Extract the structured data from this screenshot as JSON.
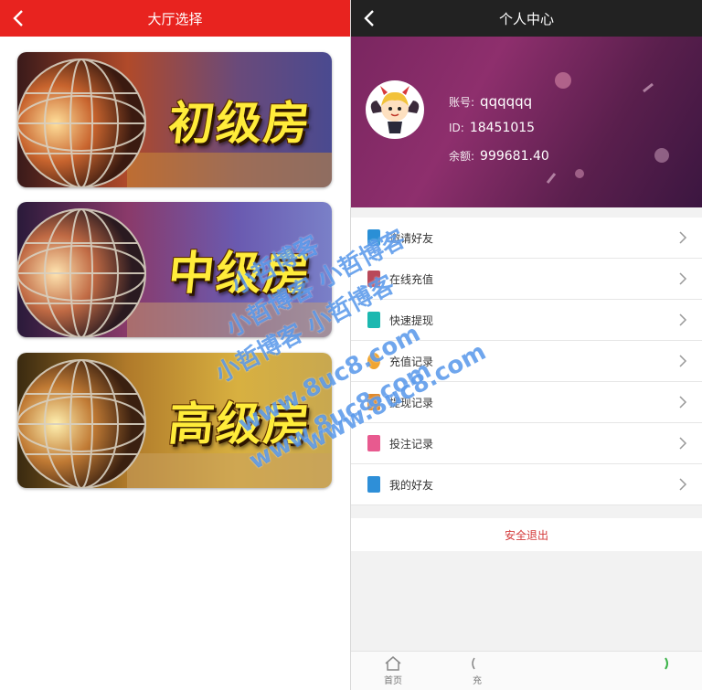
{
  "left": {
    "header": {
      "title": "大厅选择"
    },
    "rooms": [
      {
        "label": "初级房"
      },
      {
        "label": "中级房"
      },
      {
        "label": "高级房"
      }
    ]
  },
  "right": {
    "header": {
      "title": "个人中心"
    },
    "profile": {
      "account_label": "账号:",
      "account": "qqqqqq",
      "id_label": "ID:",
      "id": "18451015",
      "balance_label": "余额:",
      "balance": "999681.40"
    },
    "menu": [
      {
        "label": "邀请好友",
        "icon": "invite-icon",
        "color": "#2a8fd6"
      },
      {
        "label": "在线充值",
        "icon": "recharge-icon",
        "color": "#b9495a"
      },
      {
        "label": "快速提现",
        "icon": "withdraw-icon",
        "color": "#1cb8b0"
      },
      {
        "label": "充值记录",
        "icon": "recharge-record-icon",
        "color": "#f0a531"
      },
      {
        "label": "提现记录",
        "icon": "withdraw-record-icon",
        "color": "#e0892a"
      },
      {
        "label": "投注记录",
        "icon": "bet-record-icon",
        "color": "#e85a8f"
      },
      {
        "label": "我的好友",
        "icon": "friends-icon",
        "color": "#2e8fd8"
      }
    ],
    "logout": "安全退出",
    "tabbar": [
      {
        "label": "首页",
        "icon": "home-icon"
      },
      {
        "label": "充",
        "icon": "recharge-tab-icon"
      },
      {
        "label": "",
        "icon": "user-tab-icon"
      }
    ]
  },
  "watermark": {
    "lines": [
      "小哲博客",
      "小哲博客 小哲博客",
      "小哲博客 小哲博客",
      "www.8uc8.com",
      "www.8uc8.com",
      "www.8uc8.com"
    ]
  }
}
